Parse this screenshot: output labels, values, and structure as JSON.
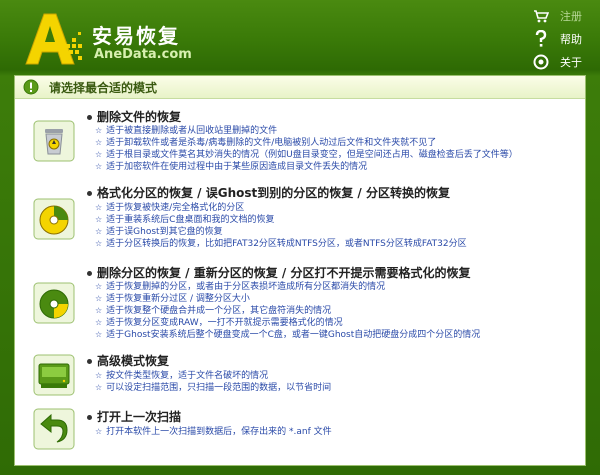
{
  "app": {
    "title": "安易恢复",
    "domain": "AneData.com"
  },
  "menu": {
    "register": "注册",
    "help": "帮助",
    "about": "关于"
  },
  "panel": {
    "title": "请选择最合适的模式"
  },
  "options": [
    {
      "title": "删除文件的恢复",
      "icon": "recycle-bin-icon",
      "lines": [
        "适于被直接删除或者从回收站里删掉的文件",
        "适于卸载软件或者是杀毒/病毒删除的文件/电脑被别人动过后文件和文件夹就不见了",
        "适于根目录或文件莫名其妙消失的情况（例如U盘目录变空，但是空间还占用、磁盘检查后丢了文件等）",
        "适于加密软件在使用过程中由于某些原因造成目录文件丢失的情况"
      ]
    },
    {
      "title": "格式化分区的恢复 / 误Ghost到别的分区的恢复 / 分区转换的恢复",
      "icon": "disk-format-icon",
      "lines": [
        "适于恢复被快速/完全格式化的分区",
        "适于重装系统后C盘桌面和我的文档的恢复",
        "适于误Ghost到其它盘的恢复",
        "适于分区转换后的恢复，比如把FAT32分区转成NTFS分区，或者NTFS分区转成FAT32分区"
      ]
    },
    {
      "title": "删除分区的恢复 / 重新分区的恢复 / 分区打不开提示需要格式化的恢复",
      "icon": "partition-icon",
      "lines": [
        "适于恢复删掉的分区，或者由于分区表损坏造成所有分区都消失的情况",
        "适于恢复重新分过区 / 调整分区大小",
        "适于恢复整个硬盘合并成一个分区，其它盘符消失的情况",
        "适于恢复分区变成RAW，一打不开就提示需要格式化的情况",
        "适于Ghost安装系统后整个硬盘变成一个C盘，或者一键Ghost自动把硬盘分成四个分区的情况"
      ]
    },
    {
      "title": "高级模式恢复",
      "icon": "hard-drive-icon",
      "lines": [
        "按文件类型恢复，适于文件名破坏的情况",
        "可以设定扫描范围，只扫描一段范围的数据，以节省时间"
      ]
    },
    {
      "title": "打开上一次扫描",
      "icon": "back-arrow-icon",
      "lines": [
        "打开本软件上一次扫描到数据后，保存出来的 *.anf 文件"
      ]
    }
  ],
  "colors": {
    "brand_green": "#3a7a08",
    "link_blue": "#2a4aa8",
    "panel_border": "#9cc070"
  }
}
